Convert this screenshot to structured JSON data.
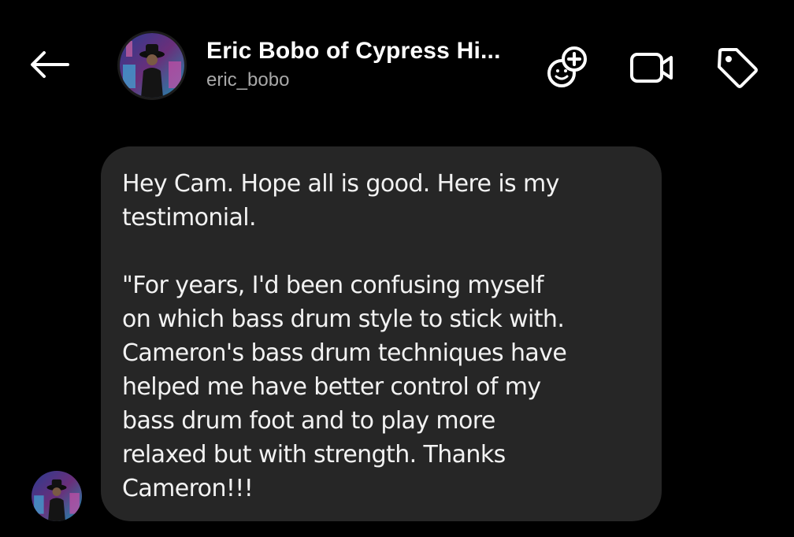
{
  "header": {
    "display_name": "Eric Bobo of Cypress Hi...",
    "username": "eric_bobo"
  },
  "icons": {
    "back": "arrow-left-icon",
    "sticker": "add-sticker-icon",
    "video": "video-camera-icon",
    "tag": "tag-icon"
  },
  "message": {
    "lines_p1": [
      "Hey Cam. Hope all is good. Here is my",
      "testimonial."
    ],
    "lines_p2": [
      "\"For years, I'd been confusing myself",
      "on which bass drum style to stick with.",
      "Cameron's bass drum techniques have",
      "helped me have better control of my",
      "bass drum foot and to play more",
      "relaxed but with strength. Thanks",
      "Cameron!!!"
    ]
  },
  "colors": {
    "background": "#000000",
    "bubble": "#262626",
    "username": "#a8a8a8",
    "text": "#ffffff"
  }
}
